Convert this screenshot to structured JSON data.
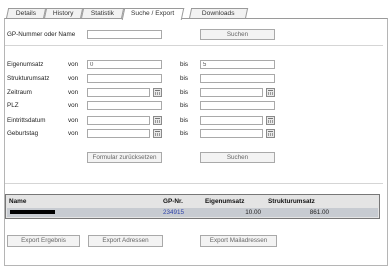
{
  "tabs": [
    {
      "label": "Details"
    },
    {
      "label": "History"
    },
    {
      "label": "Statistik"
    },
    {
      "label": "Suche / Export",
      "active": true
    },
    {
      "label": "Downloads"
    }
  ],
  "search_top": {
    "label": "GP-Nummer oder Name",
    "value": "",
    "button": "Suchen"
  },
  "filters": {
    "von": "von",
    "bis": "bis",
    "rows": [
      {
        "label": "Eigenumsatz",
        "from": "0",
        "to": "5",
        "calendar": false
      },
      {
        "label": "Strukturumsatz",
        "from": "",
        "to": "",
        "calendar": false
      },
      {
        "label": "Zeitraum",
        "from": "",
        "to": "",
        "calendar": true
      },
      {
        "label": "PLZ",
        "from": "",
        "to": "",
        "calendar": false
      },
      {
        "label": "Eintrittsdatum",
        "from": "",
        "to": "",
        "calendar": true
      },
      {
        "label": "Geburtstag",
        "from": "",
        "to": "",
        "calendar": true
      }
    ],
    "reset_button": "Formular zurücksetzen",
    "search_button": "Suchen"
  },
  "results": {
    "columns": [
      "Name",
      "GP-Nr.",
      "Eigenumsatz",
      "Strukturumsatz"
    ],
    "rows": [
      {
        "name": "",
        "gp_nr": "234915",
        "eigenumsatz": "10.00",
        "strukturumsatz": "861.00"
      }
    ],
    "link_color": "#2a3fa8",
    "row_color": "#c7cbd1"
  },
  "export": {
    "results": "Export Ergebnis",
    "addresses": "Export Adressen",
    "mail": "Export Mailadressen"
  }
}
